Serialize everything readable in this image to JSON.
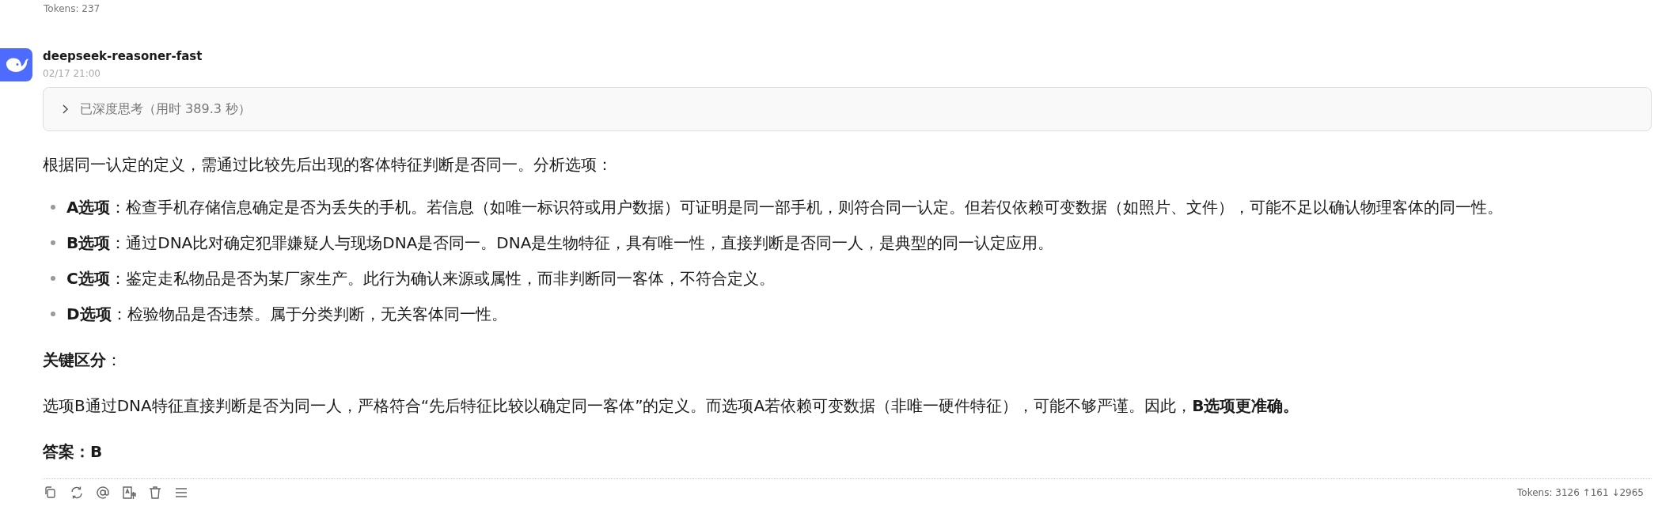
{
  "previous_tokens": "Tokens: 237",
  "message": {
    "sender": "deepseek-reasoner-fast",
    "time": "02/17 21:00",
    "thinking": {
      "label": "已深度思考（用时 389.3 秒）",
      "expanded": false
    },
    "blocks": [
      {
        "kind": "paragraph",
        "text": "根据同一认定的定义，需通过比较先后出现的客体特征判断是否同一。分析选项："
      },
      {
        "kind": "list",
        "items": [
          "**A选项**：检查手机存储信息确定是否为丢失的手机。若信息（如唯一标识符或用户数据）可证明是同一部手机，则符合同一认定。但若仅依赖可变数据（如照片、文件），可能不足以确认物理客体的同一性。",
          "**B选项**：通过DNA比对确定犯罪嫌疑人与现场DNA是否同一。DNA是生物特征，具有唯一性，直接判断是否同一人，是典型的同一认定应用。",
          "**C选项**：鉴定走私物品是否为某厂家生产。此行为确认来源或属性，而非判断同一客体，不符合定义。",
          "**D选项**：检验物品是否违禁。属于分类判断，无关客体同一性。"
        ]
      },
      {
        "kind": "paragraph",
        "text": "**关键区分**："
      },
      {
        "kind": "paragraph",
        "text": "选项B通过DNA特征直接判断是否为同一人，严格符合“先后特征比较以确定同一客体”的定义。而选项A若依赖可变数据（非唯一硬件特征），可能不够严谨。因此，**B选项更准确。**"
      },
      {
        "kind": "answer",
        "text": "答案：B"
      }
    ],
    "tokens": "Tokens: 3126 ↑161 ↓2965"
  }
}
